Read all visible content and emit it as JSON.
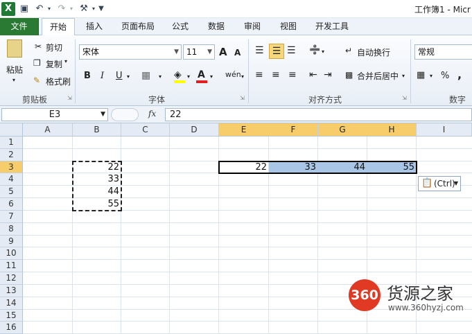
{
  "window": {
    "title": "工作簿1 - Micr"
  },
  "ribbon": {
    "tabs": [
      "文件",
      "开始",
      "插入",
      "页面布局",
      "公式",
      "数据",
      "审阅",
      "视图",
      "开发工具"
    ],
    "clipboard": {
      "paste": "粘贴",
      "cut": "剪切",
      "copy": "复制",
      "format_painter": "格式刷",
      "group": "剪贴板"
    },
    "font": {
      "name": "宋体",
      "size": "11",
      "group": "字体",
      "bold": "B",
      "italic": "I",
      "underline": "U",
      "grow": "A",
      "shrink": "A",
      "font_color": "A",
      "phonetic": "wén"
    },
    "alignment": {
      "wrap_text": "自动换行",
      "merge_center": "合并后居中",
      "group": "对齐方式"
    },
    "number": {
      "format": "常规",
      "percent": "%",
      "comma": ",",
      "group": "数字"
    }
  },
  "formula_bar": {
    "name_box": "E3",
    "fx": "fx",
    "value": "22"
  },
  "grid": {
    "columns": [
      "A",
      "B",
      "C",
      "D",
      "E",
      "F",
      "G",
      "H",
      "I"
    ],
    "rows": [
      "1",
      "2",
      "3",
      "4",
      "5",
      "6",
      "7",
      "8",
      "9",
      "10",
      "11",
      "12",
      "13",
      "14",
      "15",
      "16"
    ],
    "column_b_values": [
      "22",
      "33",
      "44",
      "55"
    ],
    "row3_values": [
      "22",
      "33",
      "44",
      "55"
    ],
    "paste_options_label": "(Ctrl)"
  },
  "watermark": {
    "badge": "360",
    "name": "货源之家",
    "url": "www.360hyzj.com"
  },
  "colors": {
    "file_tab": "#2a7a34",
    "selected_header": "#f6cd6a",
    "selection_fill": "#a9c6e6",
    "watermark_red": "#e03a24"
  }
}
